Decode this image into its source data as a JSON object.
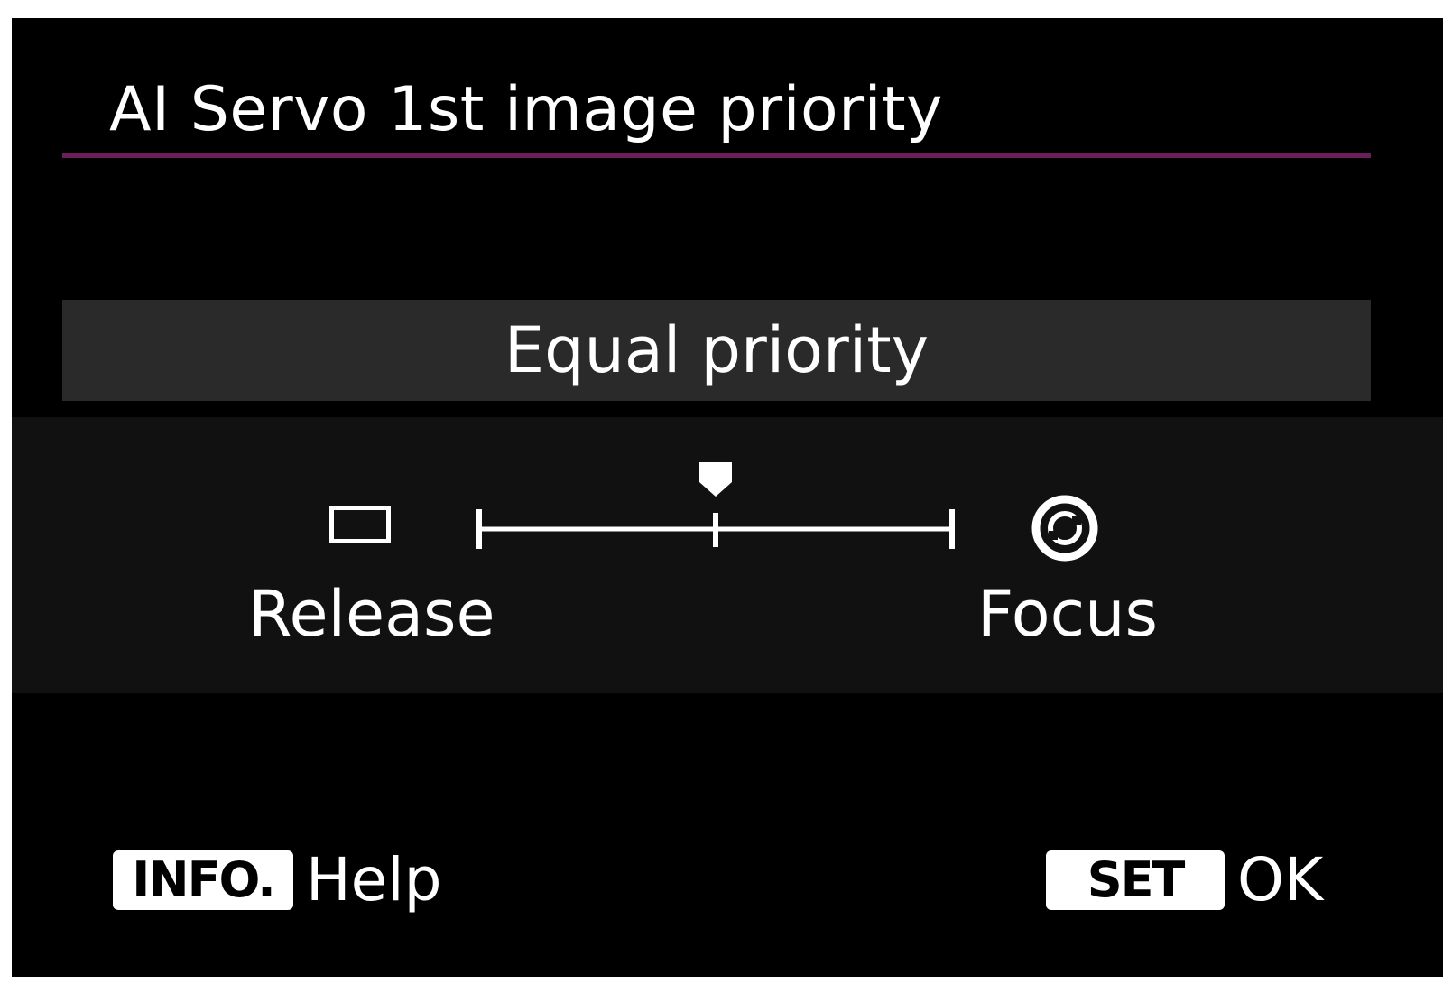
{
  "screen": {
    "title": "AI Servo 1st image priority",
    "accent_color": "#6a1e5c",
    "background_color": "#000000"
  },
  "selection": {
    "current_label": "Equal priority",
    "slider_value": 0.5,
    "slider_min_label": "Release",
    "slider_max_label": "Focus",
    "slider_min_icon": "release-rectangle-icon",
    "slider_max_icon": "focus-rotate-icon"
  },
  "footer": {
    "help_key": "INFO.",
    "help_action": "Help",
    "ok_key": "SET",
    "ok_action": "OK"
  }
}
